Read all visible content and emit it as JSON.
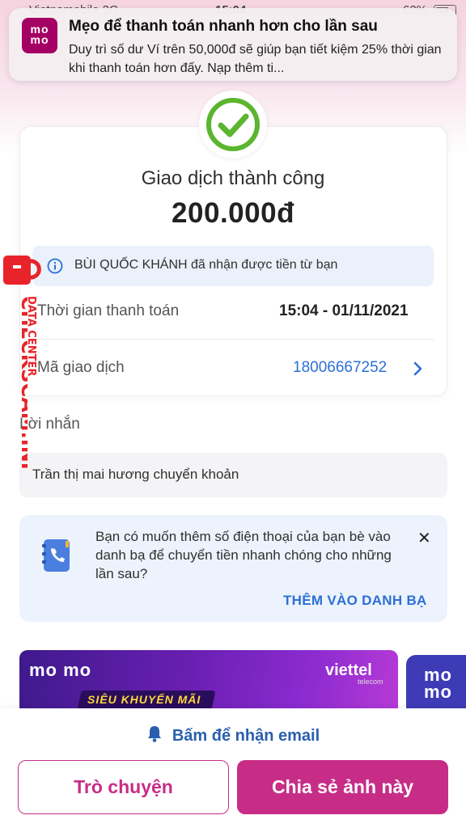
{
  "status_bar": {
    "carrier": "Vietnamobile  3G",
    "time": "15:04",
    "battery": "62%"
  },
  "notification": {
    "logo": "mo mo",
    "title": "Mẹo để thanh toán nhanh hơn cho lần sau",
    "body": "Duy trì số dư Ví trên 50,000đ sẽ giúp bạn tiết kiệm 25% thời gian khi thanh toán hơn đấy. Nạp thêm ti..."
  },
  "transaction": {
    "status": "Giao dịch thành công",
    "amount": "200.000đ",
    "info": "BÙI QUỐC KHÁNH đã nhận được tiền từ bạn",
    "time_label": "Thời gian thanh toán",
    "time_value": "15:04 - 01/11/2021",
    "id_label": "Mã giao dịch",
    "id_value": "18006667252"
  },
  "message": {
    "label": "Lời nhắn",
    "text": "Trần thị mai hương chuyển khoản"
  },
  "contact_suggestion": {
    "text": "Bạn có muốn thêm số điện thoại của bạn bè vào danh bạ để chuyển tiền nhanh chóng cho những lần sau?",
    "action": "THÊM VÀO DANH BẠ"
  },
  "promo": {
    "logo": "mo mo",
    "brand": "viettel",
    "brand_sub": "telecom",
    "tag": "SIÊU KHUYẾN MÃI",
    "logo2": "mo mo"
  },
  "bottom": {
    "email_label": "Bấm để nhận email",
    "chat_button": "Trò chuyện",
    "share_button": "Chia sẻ ảnh này"
  },
  "watermark": {
    "main": "CHECKSCAM.INFO",
    "sub": "DATA CENTER"
  },
  "colors": {
    "brand": "#c72d87",
    "success": "#5bb52f",
    "link": "#2c6fd6"
  }
}
